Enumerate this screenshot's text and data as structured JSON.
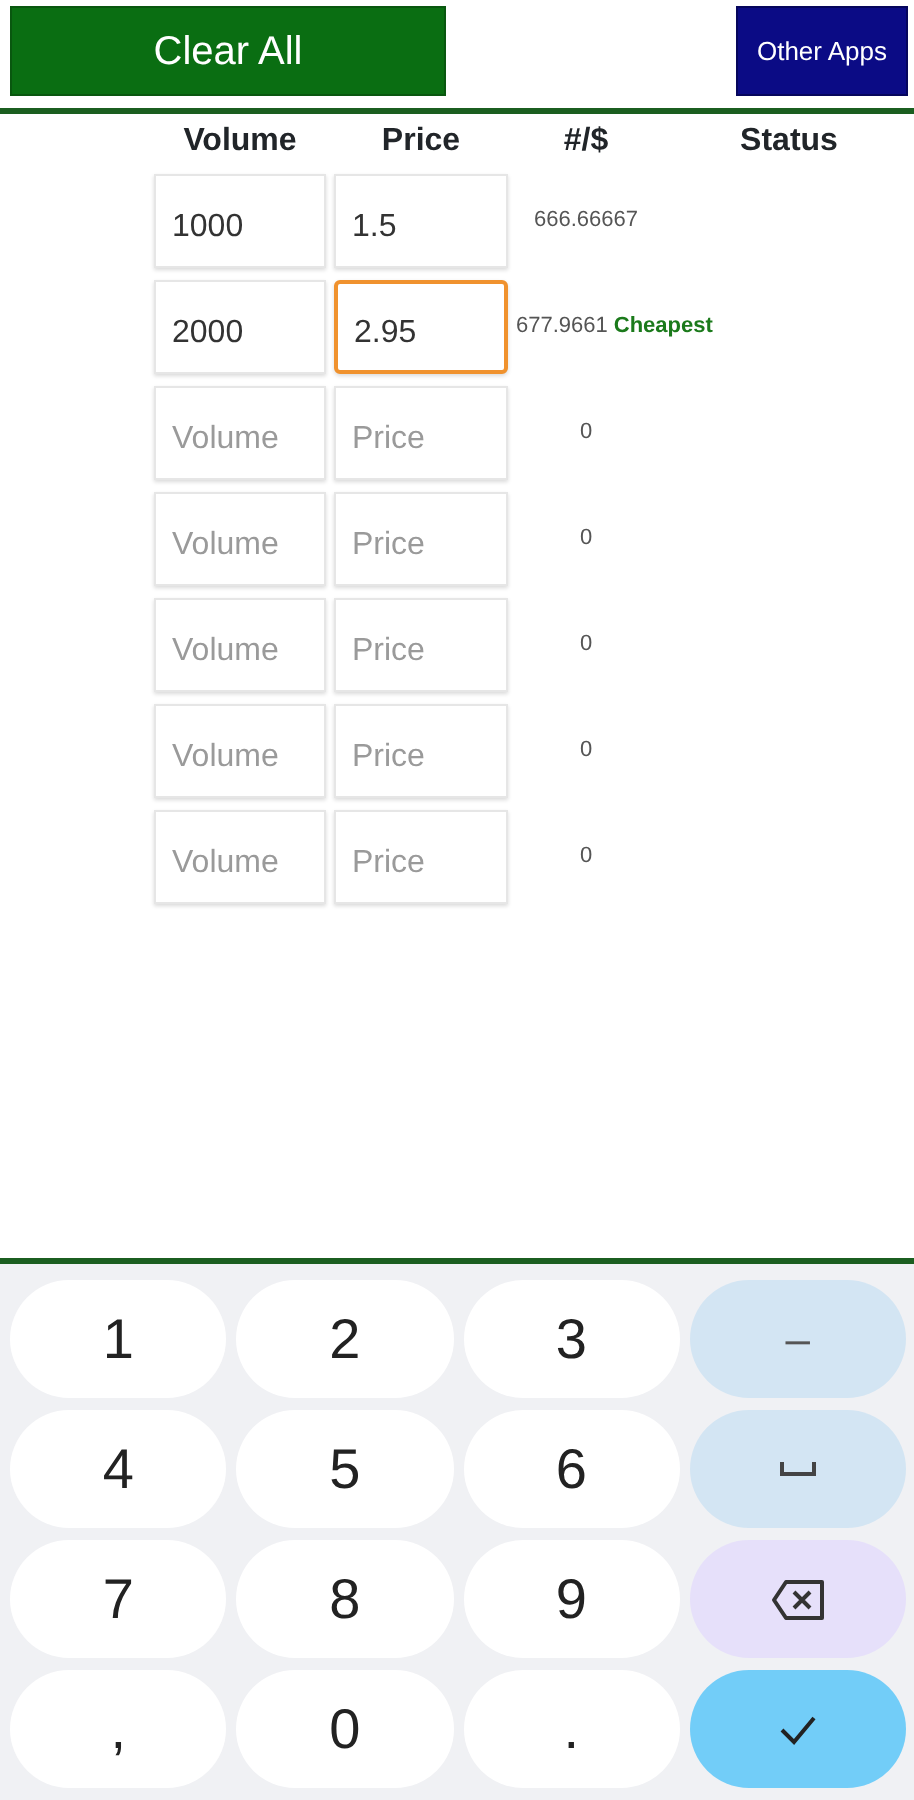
{
  "toolbar": {
    "clear_button": "Clear All",
    "other_apps_button": "Other Apps"
  },
  "columns": [
    "Volume",
    "Price",
    "#/$",
    "Status"
  ],
  "rows": [
    {
      "volume": {
        "value": "1000",
        "focused": false
      },
      "price": {
        "value": "1.5",
        "focused": false
      },
      "ratio": "666.66667"
    },
    {
      "volume": {
        "value": "2000",
        "focused": false
      },
      "price": {
        "value": "2.95",
        "focused": true
      },
      "ratio": "677.9661",
      "status": "Cheapest"
    },
    {
      "volume": {
        "placeholder": "Volume",
        "focused": false
      },
      "price": {
        "placeholder": "Price",
        "focused": false
      },
      "ratio": "0"
    },
    {
      "volume": {
        "placeholder": "Volume",
        "focused": false
      },
      "price": {
        "placeholder": "Price",
        "focused": false
      },
      "ratio": "0"
    },
    {
      "volume": {
        "placeholder": "Volume",
        "focused": false
      },
      "price": {
        "placeholder": "Price",
        "focused": false
      },
      "ratio": "0"
    },
    {
      "volume": {
        "placeholder": "Volume",
        "focused": false
      },
      "price": {
        "placeholder": "Price",
        "focused": false
      },
      "ratio": "0"
    },
    {
      "volume": {
        "placeholder": "Volume",
        "focused": false
      },
      "price": {
        "placeholder": "Price",
        "focused": false
      },
      "ratio": "0"
    }
  ],
  "keyboard": [
    {
      "kind": "digit",
      "label": "1"
    },
    {
      "kind": "digit",
      "label": "2"
    },
    {
      "kind": "digit",
      "label": "3"
    },
    {
      "kind": "symbol",
      "label": "–"
    },
    {
      "kind": "digit",
      "label": "4"
    },
    {
      "kind": "digit",
      "label": "5"
    },
    {
      "kind": "digit",
      "label": "6"
    },
    {
      "kind": "space"
    },
    {
      "kind": "digit",
      "label": "7"
    },
    {
      "kind": "digit",
      "label": "8"
    },
    {
      "kind": "digit",
      "label": "9"
    },
    {
      "kind": "backspace"
    },
    {
      "kind": "digit",
      "label": ","
    },
    {
      "kind": "digit",
      "label": "0"
    },
    {
      "kind": "digit",
      "label": "."
    },
    {
      "kind": "enter"
    }
  ]
}
